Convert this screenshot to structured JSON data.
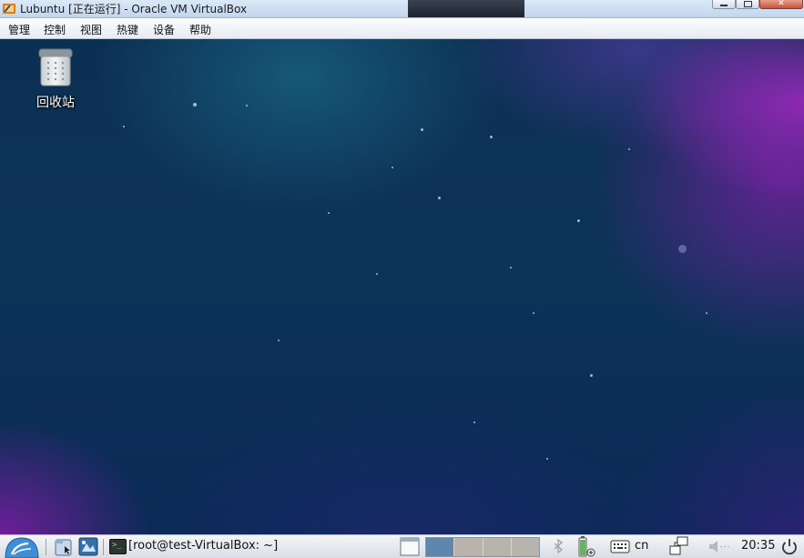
{
  "window": {
    "title": "Lubuntu [正在运行] - Oracle VM VirtualBox",
    "icon": "virtualbox-icon",
    "controls": [
      "minimize-icon",
      "maximize-icon",
      "close-icon"
    ]
  },
  "menubar": {
    "items": [
      "管理",
      "控制",
      "视图",
      "热键",
      "设备",
      "帮助"
    ]
  },
  "desktop": {
    "icons": [
      {
        "label": "回收站",
        "icon": "trash-icon"
      }
    ]
  },
  "taskbar": {
    "start_icon": "lubuntu-start-icon",
    "launchers": [
      "file-manager-icon",
      "show-desktop-icon"
    ],
    "tasks": [
      {
        "label": "[root@test-VirtualBox: ~]",
        "icon": "terminal-icon"
      }
    ],
    "window_list_icon": "window-list-icon",
    "workspaces": {
      "count": 4,
      "active_index": 0
    },
    "tray": {
      "bluetooth_icon": "bluetooth-icon",
      "battery_icon": "battery-icon",
      "keyboard_icon": "keyboard-icon",
      "keyboard_layout": "cn",
      "network_icon": "network-icon",
      "volume_icon": "volume-icon",
      "clock": "20:35",
      "power_icon": "power-icon"
    }
  },
  "colors": {
    "active_workspace": "#5f87ad",
    "desktop_base": "#0d3358",
    "desktop_purple": "#8a22b8"
  }
}
